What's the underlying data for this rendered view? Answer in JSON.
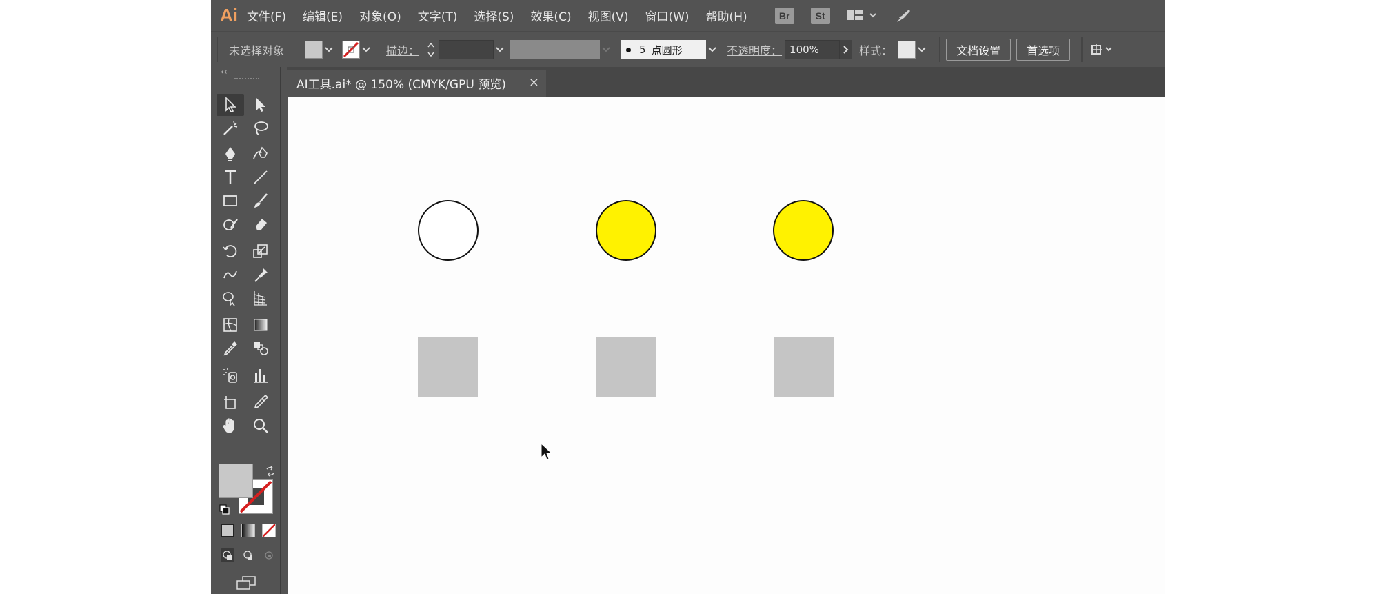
{
  "app": {
    "logo": "Ai",
    "menus": [
      "文件(F)",
      "编辑(E)",
      "对象(O)",
      "文字(T)",
      "选择(S)",
      "效果(C)",
      "视图(V)",
      "窗口(W)",
      "帮助(H)"
    ],
    "bridge_label": "Br",
    "stock_label": "St"
  },
  "control_bar": {
    "selection_status": "未选择对象",
    "stroke_label": "描边：",
    "brush_size": "5",
    "brush_label": "点圆形",
    "opacity_label": "不透明度：",
    "opacity_value": "100%",
    "style_label": "样式：",
    "doc_setup_button": "文档设置",
    "preferences_button": "首选项"
  },
  "document": {
    "tab_title": "AI工具.ai* @ 150% (CMYK/GPU 预览)",
    "close_glyph": "×"
  },
  "tools_panel": {
    "collapse_glyph": "‹‹"
  },
  "canvas": {
    "circles": [
      {
        "fill": "#ffffff",
        "stroke": "#111111"
      },
      {
        "fill": "#fff200",
        "stroke": "#111111"
      },
      {
        "fill": "#fff200",
        "stroke": "#111111"
      }
    ],
    "squares": [
      {
        "fill": "#c5c5c5"
      },
      {
        "fill": "#c5c5c5"
      },
      {
        "fill": "#c5c5c5"
      }
    ]
  },
  "colors": {
    "ui_bg": "#535353",
    "canvas_bg": "#fdfdfd",
    "accent_logo": "#f0a060",
    "no_stroke_red": "#d62020"
  }
}
